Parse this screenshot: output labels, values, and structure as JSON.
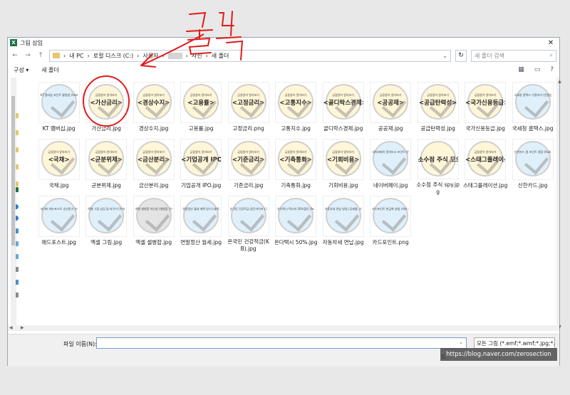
{
  "window": {
    "title": "그림 삽입",
    "close_glyph": "✕"
  },
  "nav": {
    "back": "←",
    "forward": "→",
    "up": "↑",
    "breadcrumb": [
      "내 PC",
      "로컬 디스크 (C:)",
      "사용자",
      "",
      "사진",
      "새 폴더"
    ],
    "separator": "›",
    "dropdown": "⌄",
    "refresh": "↻",
    "search_placeholder": "새 폴더 검색",
    "search_icon": "⌕"
  },
  "toolbar": {
    "organize": "구성 ▾",
    "new_folder": "새 폴더",
    "view_icon": "▦",
    "pane_icon": "▭",
    "help_icon": "?"
  },
  "files": [
    {
      "name": "KT 멤버십.jpg",
      "sub": "KT 멤버십 포인트 활용법 (feat. 영화, VIP, 카페)",
      "big": "",
      "style": "blue"
    },
    {
      "name": "가산금리.jpg",
      "sub": "금융용어 알아보기",
      "big": "<가산금리>",
      "style": "yellow"
    },
    {
      "name": "경상수지.jpg",
      "sub": "금융용어 알아보기",
      "big": "<경상수지>",
      "style": "yellow"
    },
    {
      "name": "고용률.jpg",
      "sub": "금융용어 알아보기",
      "big": "<고용률>",
      "style": "yellow"
    },
    {
      "name": "고정금리.png",
      "sub": "금융용어 알아보기",
      "big": "<고정금리>",
      "style": "yellow"
    },
    {
      "name": "고통지수.jpg",
      "sub": "금융용어 알아보기",
      "big": "<고통지수>",
      "style": "yellow"
    },
    {
      "name": "골디락스경제.jpg",
      "sub": "금융용어 알아보기",
      "big": "<골디락스경제>",
      "style": "yellow"
    },
    {
      "name": "공공재.jpg",
      "sub": "금융용어 알아보기",
      "big": "<공공재>",
      "style": "yellow"
    },
    {
      "name": "공급탄력성.jpg",
      "sub": "금융용어 알아보기",
      "big": "<공급탄력성>",
      "style": "yellow"
    },
    {
      "name": "국가신용등급.jpg",
      "sub": "금융용어 알아보기",
      "big": "<국가신용등급>",
      "style": "yellow"
    },
    {
      "name": "국세청 홈택스.jpg",
      "sub": "국세청 홈택스 이용하기 (연말정산 간소화 서비스)",
      "big": "",
      "style": "blue"
    },
    {
      "name": "국채.jpg",
      "sub": "금융용어 알아보기",
      "big": "<국채>",
      "style": "yellow"
    },
    {
      "name": "균분위제.jpg",
      "sub": "금융용어 알아보기",
      "big": "<균분위제>",
      "style": "yellow"
    },
    {
      "name": "금산분리.jpg",
      "sub": "금융용어 알아보기",
      "big": "<금산분리>",
      "style": "yellow"
    },
    {
      "name": "기업공개 IPO.jpg",
      "sub": "금융용어 알아보기",
      "big": "<기업공개 IPO>",
      "style": "yellow"
    },
    {
      "name": "기준금리.jpg",
      "sub": "금융용어 알아보기",
      "big": "<기준금리>",
      "style": "yellow"
    },
    {
      "name": "기축통화.jpg",
      "sub": "금융용어 알아보기",
      "big": "<기축통화>",
      "style": "yellow"
    },
    {
      "name": "기회비용.jpg",
      "sub": "금융용어 알아보기",
      "big": "<기회비용>",
      "style": "yellow"
    },
    {
      "name": "네이버페이.jpg",
      "sub": "네이버페이 알아보고 포인트 받기 (feat. 포인트 사용 방법)",
      "big": "",
      "style": "blue"
    },
    {
      "name": "소수점 주식 spy.jpg",
      "sub": "",
      "big": "소수점 주식 모으기",
      "style": "yellow"
    },
    {
      "name": "스태그플레이션.jpg",
      "sub": "금융용어 알아보기",
      "big": "<스태그플레이션>",
      "style": "yellow"
    },
    {
      "name": "신한카드.jpg",
      "sub": "신한카드 앱 포인트 결합 (feat. 사용 후 적립혜택)",
      "big": "",
      "style": "blue"
    },
    {
      "name": "애드포스트.jpg",
      "sub": "네이버 애드포스트 승인받기 (미승인 이유 및 꿀팁)",
      "big": "",
      "style": "blue"
    },
    {
      "name": "엑셀 그림.jpg",
      "sub": "엑셀 그림 삽입 및 바꾸기 (이미지 정렬하기 팁)",
      "big": "",
      "style": "blue"
    },
    {
      "name": "엑셀 셀병합.jpg",
      "sub": "엑셀 셀병합 하는법 (셀병합 단축키 포함)",
      "big": "",
      "style": "gray"
    },
    {
      "name": "연말정산 월세.jpg",
      "sub": "연말정산 월세 혜택 받기 (세액공제 요건 및 방법)",
      "big": "",
      "style": "blue"
    },
    {
      "name": "온국민 건강적금(KB).jpg",
      "sub": "온국민 건강적금-골든라이프 (국민은행 연 10%)",
      "big": "",
      "style": "blue"
    },
    {
      "name": "온다택시 50%.jpg",
      "sub": "온다택시 택시비 50%할인 (feat. 일반택시 쿠폰)",
      "big": "",
      "style": "blue"
    },
    {
      "name": "자동차세 연납.jpg",
      "sub": "자동차세 연납 방법 (공제율, 기간 및 절약방법)",
      "big": "",
      "style": "blue"
    },
    {
      "name": "카드포인트.png",
      "sub": "카드포인트 현금화 방법 (여러 카드사 조회하기)",
      "big": "",
      "style": "blue"
    }
  ],
  "footer": {
    "filename_label": "파일 이름(N):",
    "filename_value": "",
    "filter": "모든 그림 (*.emf;*.wmf;*.jpg;*.",
    "tools": "도",
    "dropdown": "⌄"
  },
  "watermark": "https://blog.naver.com/zerosection",
  "annotation": {
    "text": "클릭",
    "color": "#e01b1b"
  },
  "colors": {
    "excel_green": "#1e7145",
    "folder": "#e8c56b",
    "annotation_red": "#e01b1b"
  }
}
